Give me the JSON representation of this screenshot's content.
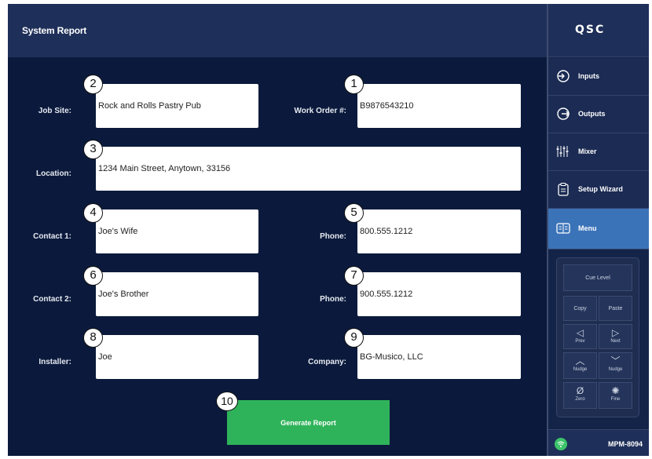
{
  "header": {
    "title": "System Report"
  },
  "brand": {
    "logo_text": "QSC"
  },
  "form": {
    "job_site": {
      "label": "Job Site:",
      "value": "Rock and Rolls Pastry Pub",
      "callout": "2"
    },
    "work_order": {
      "label": "Work Order #:",
      "value": "B9876543210",
      "callout": "1"
    },
    "location": {
      "label": "Location:",
      "value": "1234 Main Street, Anytown, 33156",
      "callout": "3"
    },
    "contact1": {
      "label": "Contact 1:",
      "value": "Joe's Wife",
      "callout": "4"
    },
    "phone1": {
      "label": "Phone:",
      "value": "800.555.1212",
      "callout": "5"
    },
    "contact2": {
      "label": "Contact 2:",
      "value": "Joe's Brother",
      "callout": "6"
    },
    "phone2": {
      "label": "Phone:",
      "value": "900.555.1212",
      "callout": "7"
    },
    "installer": {
      "label": "Installer:",
      "value": "Joe",
      "callout": "8"
    },
    "company": {
      "label": "Company:",
      "value": "BG-Musico, LLC",
      "callout": "9"
    },
    "generate": {
      "label": "Generate Report",
      "callout": "10"
    }
  },
  "sidebar": {
    "items": [
      {
        "label": "Inputs",
        "icon": "input-icon"
      },
      {
        "label": "Outputs",
        "icon": "output-icon"
      },
      {
        "label": "Mixer",
        "icon": "mixer-icon"
      },
      {
        "label": "Setup Wizard",
        "icon": "clipboard-icon"
      },
      {
        "label": "Menu",
        "icon": "menu-icon",
        "active": true
      }
    ]
  },
  "keypad": {
    "cue_level": "Cue Level",
    "copy": "Copy",
    "paste": "Paste",
    "prev": "Prev",
    "next": "Next",
    "nudge_up": "Nudge",
    "nudge_down": "Nudge",
    "zero": "Zero",
    "fine": "Fine"
  },
  "status": {
    "model": "MPM-8094"
  },
  "colors": {
    "background": "#0b1a3c",
    "header": "#1e2f59",
    "accent_active": "#3b73b8",
    "generate_button": "#2fb35a"
  }
}
